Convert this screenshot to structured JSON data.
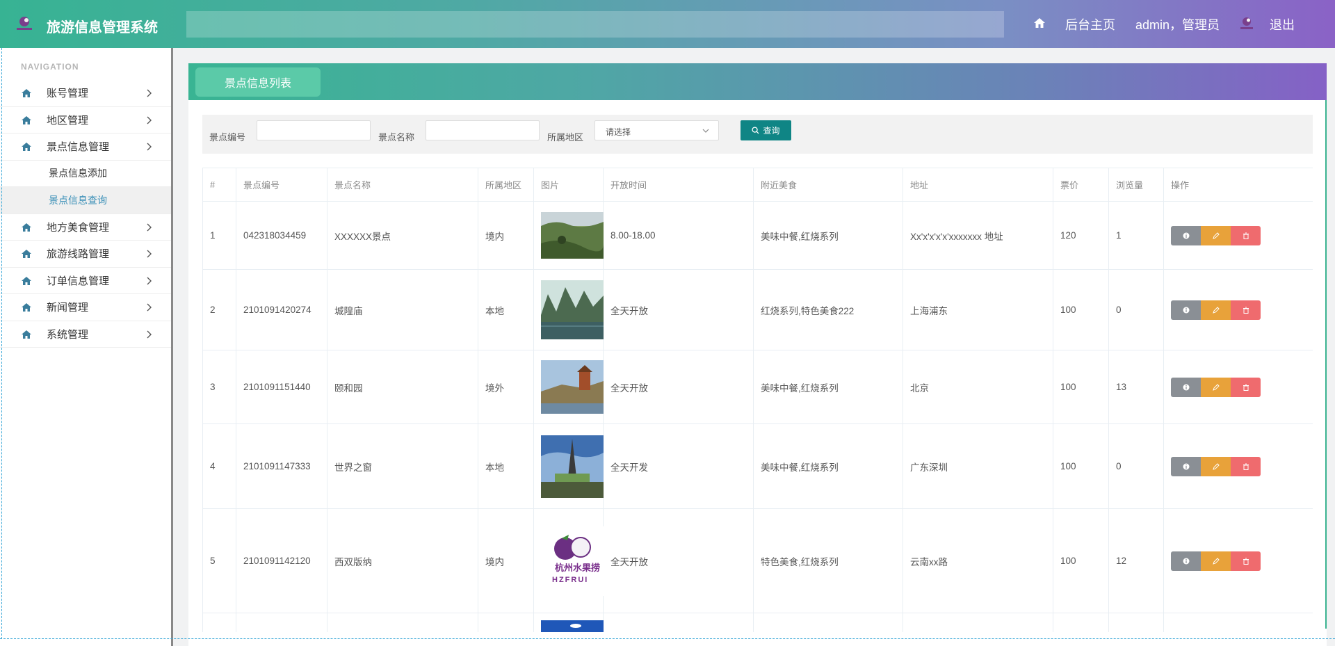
{
  "header": {
    "title": "旅游信息管理系统",
    "home_label": "后台主页",
    "user_label": "admin，管理员",
    "logout_label": "退出"
  },
  "sidebar": {
    "section_label": "NAVIGATION",
    "items": [
      {
        "label": "账号管理"
      },
      {
        "label": "地区管理"
      },
      {
        "label": "景点信息管理"
      },
      {
        "label": "地方美食管理"
      },
      {
        "label": "旅游线路管理"
      },
      {
        "label": "订单信息管理"
      },
      {
        "label": "新闻管理"
      },
      {
        "label": "系统管理"
      }
    ],
    "sub_items": [
      {
        "label": "景点信息添加"
      },
      {
        "label": "景点信息查询"
      }
    ]
  },
  "tab": {
    "label": "景点信息列表"
  },
  "filters": {
    "code_label": "景点编号",
    "name_label": "景点名称",
    "region_label": "所属地区",
    "region_placeholder": "请选择",
    "query_label": "查询"
  },
  "table": {
    "headers": [
      "#",
      "景点编号",
      "景点名称",
      "所属地区",
      "图片",
      "开放时间",
      "附近美食",
      "地址",
      "票价",
      "浏览量",
      "操作"
    ],
    "rows": [
      [
        "1",
        "042318034459",
        "XXXXXX景点",
        "境内",
        "8.00-18.00",
        "美味中餐,红烧系列",
        "Xx'x'x'x'x'xxxxxxx 地址",
        "120",
        "1"
      ],
      [
        "2",
        "2101091420274",
        "城隍庙",
        "本地",
        "全天开放",
        "红烧系列,特色美食222",
        "上海浦东",
        "100",
        "0"
      ],
      [
        "3",
        "2101091151440",
        "颐和园",
        "境外",
        "全天开放",
        "美味中餐,红烧系列",
        "北京",
        "100",
        "13"
      ],
      [
        "4",
        "2101091147333",
        "世界之窗",
        "本地",
        "全天开发",
        "美味中餐,红烧系列",
        "广东深圳",
        "100",
        "0"
      ],
      [
        "5",
        "2101091142120",
        "西双版纳",
        "境内",
        "全天开放",
        "特色美食,红烧系列",
        "云南xx路",
        "100",
        "12"
      ]
    ],
    "thumb_text_cn": "杭州水果捞",
    "thumb_text_en": "HZFRUI"
  },
  "colors": {
    "accent_teal": "#0f8585",
    "btn_info": "#8a8f95",
    "btn_edit": "#e8a23a",
    "btn_delete": "#ef6b6e"
  }
}
